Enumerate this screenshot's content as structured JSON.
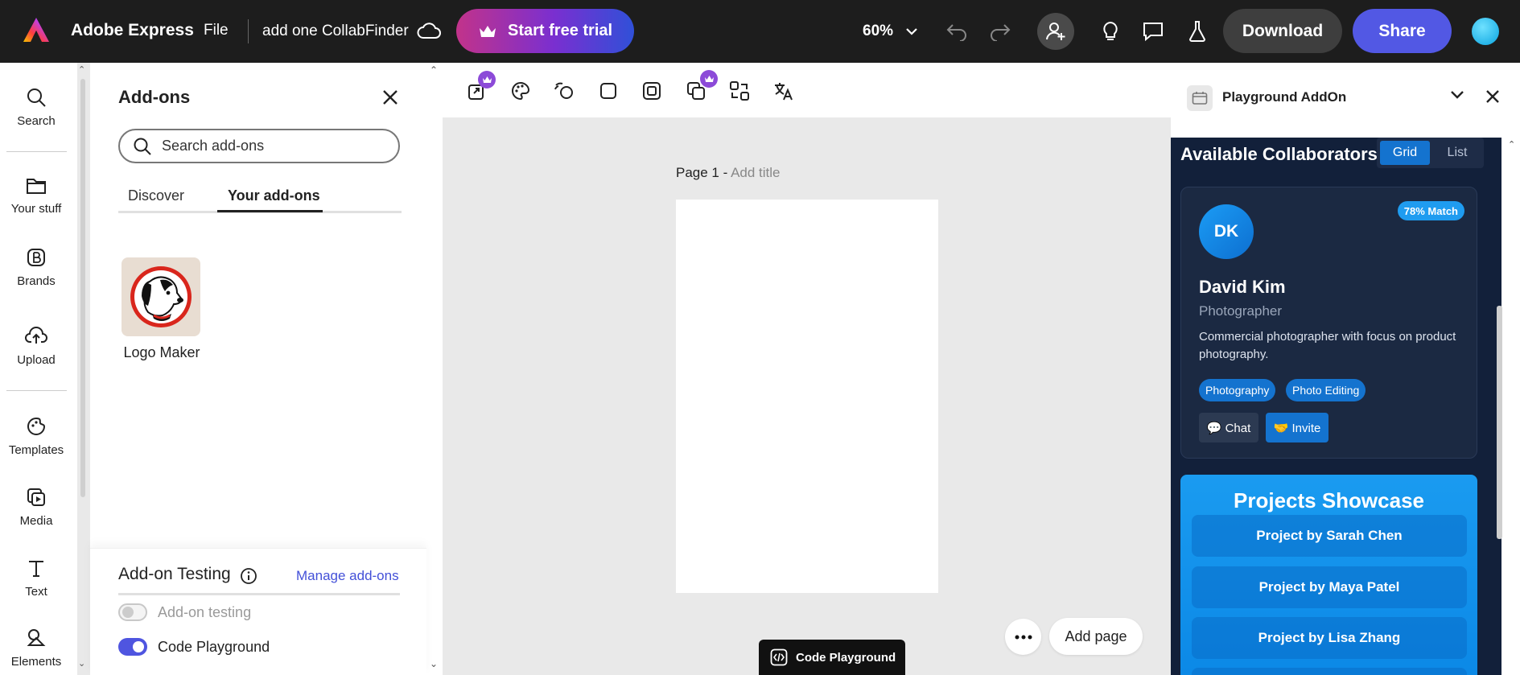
{
  "topbar": {
    "app_title": "Adobe Express",
    "file_menu": "File",
    "doc_title": "add one CollabFinder",
    "trial_label": "Start free trial",
    "zoom": "60%",
    "download_label": "Download",
    "share_label": "Share"
  },
  "rail": {
    "items": [
      {
        "label": "Search",
        "icon": "search-icon"
      },
      {
        "label": "Your stuff",
        "icon": "folder-icon"
      },
      {
        "label": "Brands",
        "icon": "brand-icon"
      },
      {
        "label": "Upload",
        "icon": "upload-icon"
      },
      {
        "label": "Templates",
        "icon": "templates-icon"
      },
      {
        "label": "Media",
        "icon": "media-icon"
      },
      {
        "label": "Text",
        "icon": "text-icon"
      },
      {
        "label": "Elements",
        "icon": "elements-icon"
      }
    ]
  },
  "addons": {
    "title": "Add-ons",
    "search_placeholder": "Search add-ons",
    "tabs": [
      "Discover",
      "Your add-ons"
    ],
    "active_tab": "Your add-ons",
    "items": [
      {
        "label": "Logo Maker"
      }
    ],
    "testing": {
      "title": "Add-on Testing",
      "manage_link": "Manage add-ons",
      "toggles": [
        {
          "label": "Add-on testing",
          "on": false
        },
        {
          "label": "Code Playground",
          "on": true
        }
      ]
    }
  },
  "canvas": {
    "page_label": "Page 1 - ",
    "page_hint": "Add title",
    "add_page": "Add page",
    "code_playground": "Code Playground"
  },
  "right_panel": {
    "title": "Playground AddOn",
    "heading": "Available Collaborators",
    "view_options": [
      "Grid",
      "List"
    ],
    "active_view": "Grid",
    "card": {
      "initials": "DK",
      "match": "78% Match",
      "name": "David Kim",
      "role": "Photographer",
      "bio": "Commercial photographer with focus on product photography.",
      "tags": [
        "Photography",
        "Photo Editing"
      ],
      "chat_label": "💬 Chat",
      "invite_label": "🤝 Invite"
    },
    "showcase": {
      "title": "Projects Showcase",
      "projects": [
        "Project by Sarah Chen",
        "Project by Maya Patel",
        "Project by Lisa Zhang"
      ]
    }
  },
  "colors": {
    "accent": "#5258e4",
    "topbar": "#1d1d1d",
    "panel_dark": "#12203a",
    "badge_blue": "#1473cf"
  }
}
